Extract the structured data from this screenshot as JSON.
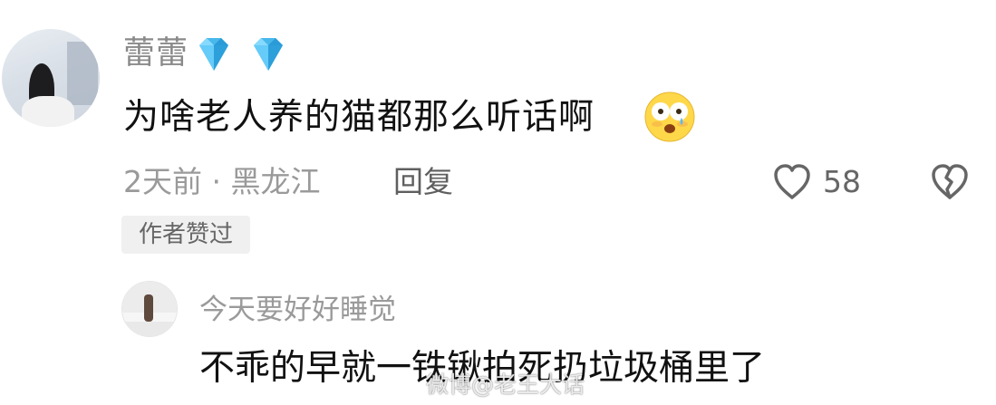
{
  "comment": {
    "username": "蕾蕾",
    "text": "为啥老人养的猫都那么听话啊",
    "meta": "2天前 · 黑龙江",
    "reply_label": "回复",
    "likes": "58",
    "author_badge": "作者赞过"
  },
  "reply_comment": {
    "username": "今天要好好睡觉",
    "text": "不乖的早就一铁锹拍死扔垃圾桶里了"
  },
  "watermark": "微博@老王大话",
  "icons": {
    "diamond": "diamond-icon",
    "emoji": "flushed-face-emoji",
    "like": "heart-outline-icon",
    "dislike": "broken-heart-icon"
  },
  "colors": {
    "text_primary": "#111111",
    "text_secondary": "#9a9a9a",
    "badge_bg": "#f0f0f0"
  }
}
